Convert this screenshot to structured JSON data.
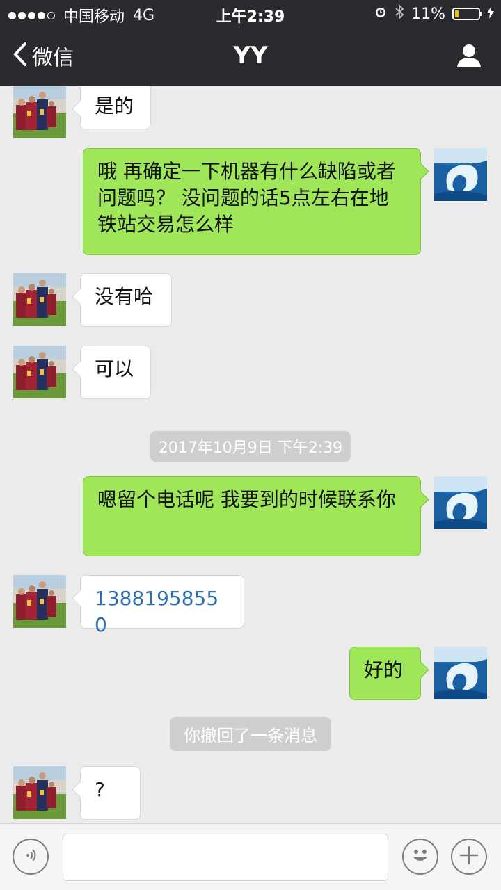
{
  "status_bar": {
    "carrier": "中国移动",
    "network": "4G",
    "time": "上午2:39",
    "battery": "11%"
  },
  "nav": {
    "back_label": "微信",
    "title": "YY"
  },
  "messages": [
    {
      "from": "contact",
      "text": "是的"
    },
    {
      "from": "me",
      "text": "哦 再确定一下机器有什么缺陷或者问题吗？ 没问题的话5点左右在地铁站交易怎么样"
    },
    {
      "from": "contact",
      "text": "没有哈"
    },
    {
      "from": "contact",
      "text": "可以"
    },
    {
      "type": "timestamp",
      "text": "2017年10月9日 下午2:39"
    },
    {
      "from": "me",
      "text": "嗯留个电话呢 我要到的时候联系你"
    },
    {
      "from": "contact",
      "text": "13881958550"
    },
    {
      "from": "me",
      "text": "好的"
    },
    {
      "type": "system",
      "text": "你撤回了一条消息"
    },
    {
      "from": "contact",
      "text": "?"
    }
  ],
  "input": {
    "placeholder": ""
  },
  "colors": {
    "bar": "#2b2b2f",
    "out_bubble": "#9fe658",
    "link": "#2a6fb5",
    "chat_bg": "#ebebeb"
  },
  "icons": [
    "back-chevron-icon",
    "profile-icon",
    "voice-icon",
    "emoji-icon",
    "plus-icon",
    "alarm-icon",
    "bluetooth-icon",
    "charging-icon"
  ]
}
